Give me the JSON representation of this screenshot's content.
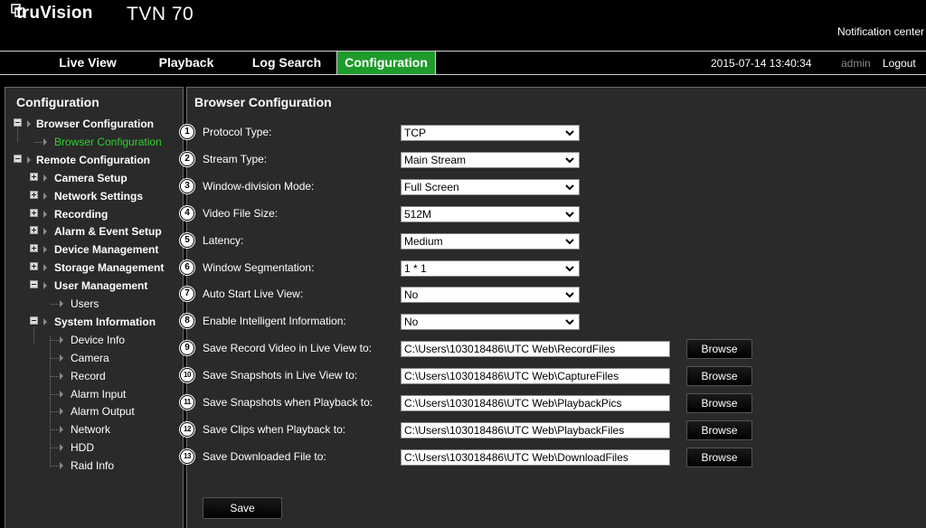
{
  "header": {
    "brand": "truVision",
    "model": "TVN 70",
    "notification": "Notification center"
  },
  "nav": {
    "items": [
      "Live View",
      "Playback",
      "Log Search",
      "Configuration"
    ],
    "active": "Configuration",
    "datetime": "2015-07-14 13:40:34",
    "user": "admin",
    "logout": "Logout"
  },
  "sidebar": {
    "title": "Configuration",
    "tree": [
      {
        "label": "Browser Configuration",
        "level": 0,
        "bold": true,
        "toggle": "minus"
      },
      {
        "label": "Browser Configuration",
        "level": 1,
        "selected": true
      },
      {
        "label": "Remote Configuration",
        "level": 0,
        "bold": true,
        "toggle": "minus"
      },
      {
        "label": "Camera Setup",
        "level": 1,
        "bold": true,
        "toggle": "plus"
      },
      {
        "label": "Network Settings",
        "level": 1,
        "bold": true,
        "toggle": "plus"
      },
      {
        "label": "Recording",
        "level": 1,
        "bold": true,
        "toggle": "plus"
      },
      {
        "label": "Alarm & Event Setup",
        "level": 1,
        "bold": true,
        "toggle": "plus"
      },
      {
        "label": "Device Management",
        "level": 1,
        "bold": true,
        "toggle": "plus"
      },
      {
        "label": "Storage Management",
        "level": 1,
        "bold": true,
        "toggle": "plus"
      },
      {
        "label": "User Management",
        "level": 1,
        "bold": true,
        "toggle": "minus"
      },
      {
        "label": "Users",
        "level": 2
      },
      {
        "label": "System Information",
        "level": 1,
        "bold": true,
        "toggle": "minus"
      },
      {
        "label": "Device Info",
        "level": 2
      },
      {
        "label": "Camera",
        "level": 2
      },
      {
        "label": "Record",
        "level": 2
      },
      {
        "label": "Alarm Input",
        "level": 2
      },
      {
        "label": "Alarm Output",
        "level": 2
      },
      {
        "label": "Network",
        "level": 2
      },
      {
        "label": "HDD",
        "level": 2
      },
      {
        "label": "Raid Info",
        "level": 2
      }
    ]
  },
  "main": {
    "title": "Browser Configuration",
    "dropdowns": [
      {
        "num": "1",
        "label": "Protocol Type:",
        "value": "TCP"
      },
      {
        "num": "2",
        "label": "Stream Type:",
        "value": "Main Stream"
      },
      {
        "num": "3",
        "label": "Window-division Mode:",
        "value": "Full Screen"
      },
      {
        "num": "4",
        "label": "Video File Size:",
        "value": "512M"
      },
      {
        "num": "5",
        "label": "Latency:",
        "value": "Medium"
      },
      {
        "num": "6",
        "label": "Window Segmentation:",
        "value": "1 * 1"
      },
      {
        "num": "7",
        "label": "Auto Start Live View:",
        "value": "No"
      },
      {
        "num": "8",
        "label": "Enable Intelligent Information:",
        "value": "No"
      }
    ],
    "paths": [
      {
        "num": "9",
        "label": "Save Record Video in Live View to:",
        "value": "C:\\Users\\103018486\\UTC Web\\RecordFiles",
        "button": "Browse"
      },
      {
        "num": "10",
        "label": "Save Snapshots in Live View to:",
        "value": "C:\\Users\\103018486\\UTC Web\\CaptureFiles",
        "button": "Browse"
      },
      {
        "num": "11",
        "label": "Save Snapshots when Playback to:",
        "value": "C:\\Users\\103018486\\UTC Web\\PlaybackPics",
        "button": "Browse"
      },
      {
        "num": "12",
        "label": "Save Clips when Playback to:",
        "value": "C:\\Users\\103018486\\UTC Web\\PlaybackFiles",
        "button": "Browse"
      },
      {
        "num": "13",
        "label": "Save Downloaded File to:",
        "value": "C:\\Users\\103018486\\UTC Web\\DownloadFiles",
        "button": "Browse"
      }
    ],
    "save_label": "Save"
  },
  "colors": {
    "accent": "#1e9b2b",
    "selected_text": "#2fd12f",
    "panel_bg": "#2a2a2a"
  }
}
